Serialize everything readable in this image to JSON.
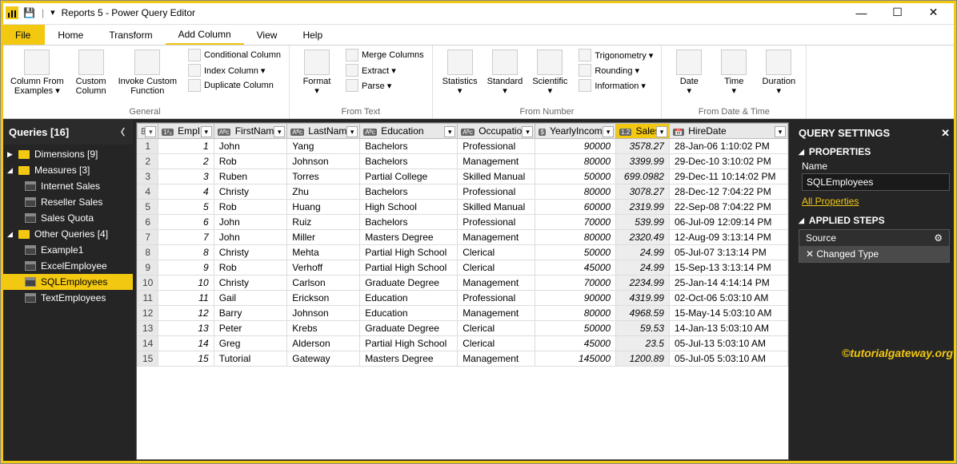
{
  "window": {
    "title": "Reports 5 - Power Query Editor",
    "qat_sep": "|",
    "min": "—",
    "max": "☐",
    "close": "✕"
  },
  "menu": {
    "file": "File",
    "tabs": [
      "Home",
      "Transform",
      "Add Column",
      "View",
      "Help"
    ],
    "activeIndex": 2
  },
  "ribbon": {
    "groups": [
      {
        "label": "General",
        "big": [
          {
            "k": "col-from-examples",
            "t": "Column From\nExamples ▾"
          },
          {
            "k": "custom-column",
            "t": "Custom\nColumn"
          },
          {
            "k": "invoke-custom-fn",
            "t": "Invoke Custom\nFunction"
          }
        ],
        "small": [
          {
            "k": "conditional-column",
            "t": "Conditional Column"
          },
          {
            "k": "index-column",
            "t": "Index Column ▾"
          },
          {
            "k": "duplicate-column",
            "t": "Duplicate Column"
          }
        ]
      },
      {
        "label": "From Text",
        "big": [
          {
            "k": "format",
            "t": "Format\n▾"
          }
        ],
        "small": [
          {
            "k": "merge-columns",
            "t": "Merge Columns"
          },
          {
            "k": "extract",
            "t": "Extract ▾"
          },
          {
            "k": "parse",
            "t": "Parse ▾"
          }
        ]
      },
      {
        "label": "From Number",
        "big": [
          {
            "k": "statistics",
            "t": "Statistics\n▾"
          },
          {
            "k": "standard",
            "t": "Standard\n▾"
          },
          {
            "k": "scientific",
            "t": "Scientific\n▾"
          }
        ],
        "small": [
          {
            "k": "trigonometry",
            "t": "Trigonometry ▾"
          },
          {
            "k": "rounding",
            "t": "Rounding ▾"
          },
          {
            "k": "information",
            "t": "Information ▾"
          }
        ]
      },
      {
        "label": "From Date & Time",
        "big": [
          {
            "k": "date",
            "t": "Date\n▾"
          },
          {
            "k": "time",
            "t": "Time\n▾"
          },
          {
            "k": "duration",
            "t": "Duration\n▾"
          }
        ],
        "small": []
      }
    ]
  },
  "queries": {
    "title": "Queries [16]",
    "groups": [
      {
        "name": "Dimensions [9]",
        "open": false,
        "items": []
      },
      {
        "name": "Measures [3]",
        "open": true,
        "items": [
          "Internet Sales",
          "Reseller Sales",
          "Sales Quota"
        ]
      },
      {
        "name": "Other Queries [4]",
        "open": true,
        "items": [
          "Example1",
          "ExcelEmployee",
          "SQLEmployees",
          "TextEmployees"
        ]
      }
    ],
    "selected": "SQLEmployees"
  },
  "columns": [
    {
      "key": "EmpID",
      "type": "1²₃",
      "sel": false
    },
    {
      "key": "FirstName",
      "type": "Aᴮc",
      "sel": false
    },
    {
      "key": "LastName",
      "type": "Aᴮc",
      "sel": false
    },
    {
      "key": "Education",
      "type": "Aᴮc",
      "sel": false
    },
    {
      "key": "Occupation",
      "type": "Aᴮc",
      "sel": false
    },
    {
      "key": "YearlyIncome",
      "type": "$",
      "sel": false
    },
    {
      "key": "Sales",
      "type": "1.2",
      "sel": true
    },
    {
      "key": "HireDate",
      "type": "📅",
      "sel": false
    }
  ],
  "rows": [
    {
      "n": 1,
      "EmpID": 1,
      "FirstName": "John",
      "LastName": "Yang",
      "Education": "Bachelors",
      "Occupation": "Professional",
      "YearlyIncome": 90000,
      "Sales": 3578.27,
      "HireDate": "28-Jan-06 1:10:02 PM"
    },
    {
      "n": 2,
      "EmpID": 2,
      "FirstName": "Rob",
      "LastName": "Johnson",
      "Education": "Bachelors",
      "Occupation": "Management",
      "YearlyIncome": 80000,
      "Sales": 3399.99,
      "HireDate": "29-Dec-10 3:10:02 PM"
    },
    {
      "n": 3,
      "EmpID": 3,
      "FirstName": "Ruben",
      "LastName": "Torres",
      "Education": "Partial College",
      "Occupation": "Skilled Manual",
      "YearlyIncome": 50000,
      "Sales": 699.0982,
      "HireDate": "29-Dec-11 10:14:02 PM"
    },
    {
      "n": 4,
      "EmpID": 4,
      "FirstName": "Christy",
      "LastName": "Zhu",
      "Education": "Bachelors",
      "Occupation": "Professional",
      "YearlyIncome": 80000,
      "Sales": 3078.27,
      "HireDate": "28-Dec-12 7:04:22 PM"
    },
    {
      "n": 5,
      "EmpID": 5,
      "FirstName": "Rob",
      "LastName": "Huang",
      "Education": "High School",
      "Occupation": "Skilled Manual",
      "YearlyIncome": 60000,
      "Sales": 2319.99,
      "HireDate": "22-Sep-08 7:04:22 PM"
    },
    {
      "n": 6,
      "EmpID": 6,
      "FirstName": "John",
      "LastName": "Ruiz",
      "Education": "Bachelors",
      "Occupation": "Professional",
      "YearlyIncome": 70000,
      "Sales": 539.99,
      "HireDate": "06-Jul-09 12:09:14 PM"
    },
    {
      "n": 7,
      "EmpID": 7,
      "FirstName": "John",
      "LastName": "Miller",
      "Education": "Masters Degree",
      "Occupation": "Management",
      "YearlyIncome": 80000,
      "Sales": 2320.49,
      "HireDate": "12-Aug-09 3:13:14 PM"
    },
    {
      "n": 8,
      "EmpID": 8,
      "FirstName": "Christy",
      "LastName": "Mehta",
      "Education": "Partial High School",
      "Occupation": "Clerical",
      "YearlyIncome": 50000,
      "Sales": 24.99,
      "HireDate": "05-Jul-07 3:13:14 PM"
    },
    {
      "n": 9,
      "EmpID": 9,
      "FirstName": "Rob",
      "LastName": "Verhoff",
      "Education": "Partial High School",
      "Occupation": "Clerical",
      "YearlyIncome": 45000,
      "Sales": 24.99,
      "HireDate": "15-Sep-13 3:13:14 PM"
    },
    {
      "n": 10,
      "EmpID": 10,
      "FirstName": "Christy",
      "LastName": "Carlson",
      "Education": "Graduate Degree",
      "Occupation": "Management",
      "YearlyIncome": 70000,
      "Sales": 2234.99,
      "HireDate": "25-Jan-14 4:14:14 PM"
    },
    {
      "n": 11,
      "EmpID": 11,
      "FirstName": "Gail",
      "LastName": "Erickson",
      "Education": "Education",
      "Occupation": "Professional",
      "YearlyIncome": 90000,
      "Sales": 4319.99,
      "HireDate": "02-Oct-06 5:03:10 AM"
    },
    {
      "n": 12,
      "EmpID": 12,
      "FirstName": "Barry",
      "LastName": "Johnson",
      "Education": "Education",
      "Occupation": "Management",
      "YearlyIncome": 80000,
      "Sales": 4968.59,
      "HireDate": "15-May-14 5:03:10 AM"
    },
    {
      "n": 13,
      "EmpID": 13,
      "FirstName": "Peter",
      "LastName": "Krebs",
      "Education": "Graduate Degree",
      "Occupation": "Clerical",
      "YearlyIncome": 50000,
      "Sales": 59.53,
      "HireDate": "14-Jan-13 5:03:10 AM"
    },
    {
      "n": 14,
      "EmpID": 14,
      "FirstName": "Greg",
      "LastName": "Alderson",
      "Education": "Partial High School",
      "Occupation": "Clerical",
      "YearlyIncome": 45000,
      "Sales": 23.5,
      "HireDate": "05-Jul-13 5:03:10 AM"
    },
    {
      "n": 15,
      "EmpID": 15,
      "FirstName": "Tutorial",
      "LastName": "Gateway",
      "Education": "Masters Degree",
      "Occupation": "Management",
      "YearlyIncome": 145000,
      "Sales": 1200.89,
      "HireDate": "05-Jul-05 5:03:10 AM"
    }
  ],
  "settings": {
    "title": "QUERY SETTINGS",
    "props": "PROPERTIES",
    "name_label": "Name",
    "name_value": "SQLEmployees",
    "all_props": "All Properties",
    "steps_label": "APPLIED STEPS",
    "steps": [
      {
        "name": "Source",
        "gear": true
      },
      {
        "name": "Changed Type",
        "gear": false
      }
    ],
    "sel_step": 1
  },
  "watermark": "©tutorialgateway.org"
}
